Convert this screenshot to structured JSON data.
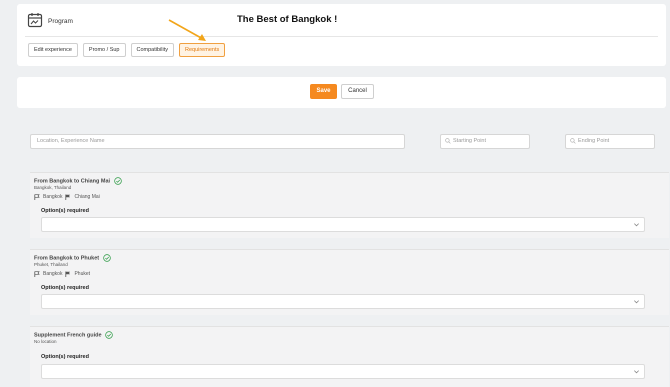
{
  "header": {
    "program_label": "Program",
    "title": "The Best of Bangkok !"
  },
  "tabs": [
    {
      "label": "Edit experience",
      "active": false
    },
    {
      "label": "Promo / Sup",
      "active": false
    },
    {
      "label": "Compatibility",
      "active": false
    },
    {
      "label": "Requirements",
      "active": true
    }
  ],
  "actions": {
    "save_label": "Save",
    "cancel_label": "Cancel"
  },
  "filters": {
    "location_placeholder": "Location, Experience Name",
    "starting_placeholder": "Starting Point",
    "ending_placeholder": "Ending Point"
  },
  "experiences": [
    {
      "title": "From Bangkok to Chiang Mai",
      "location": "Bangkok, Thailand",
      "from": "Bangkok",
      "to": "Chiang Mai",
      "options_label": "Option(s) required",
      "options_value": ""
    },
    {
      "title": "From Bangkok to Phuket",
      "location": "Phuket, Thailand",
      "from": "Bangkok",
      "to": "Phuket",
      "options_label": "Option(s) required",
      "options_value": ""
    },
    {
      "title": "Supplement French guide",
      "location": "No location",
      "options_label": "Option(s) required",
      "options_value": ""
    }
  ],
  "colors": {
    "accent": "#f5891f",
    "check": "#2e9b46",
    "active_tab_bg": "#fff3e3"
  },
  "icons": [
    "calendar-icon",
    "arrow-annotation",
    "search-icon",
    "check-shield-icon",
    "flag-outline-icon",
    "flag-filled-icon",
    "chevron-down-icon"
  ]
}
